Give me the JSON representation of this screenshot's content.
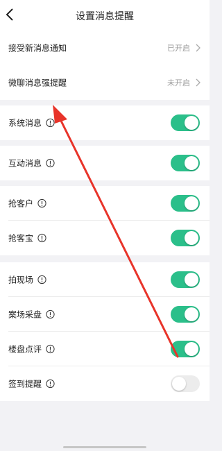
{
  "header": {
    "title": "设置消息提醒",
    "back_icon": "chevron-left-icon"
  },
  "notify_group": [
    {
      "label": "接受新消息通知",
      "value": "已开启"
    },
    {
      "label": "微聊消息强提醒",
      "value": "未开启"
    }
  ],
  "system_message": {
    "label": "系统消息",
    "on": true
  },
  "interaction_message": {
    "label": "互动消息",
    "on": true
  },
  "grab_group": [
    {
      "label": "抢客户",
      "on": true
    },
    {
      "label": "抢客宝",
      "on": true
    }
  ],
  "scene_group": [
    {
      "label": "拍现场",
      "on": true
    },
    {
      "label": "案场采盘",
      "on": true
    },
    {
      "label": "楼盘点评",
      "on": true
    },
    {
      "label": "签到提醒",
      "on": false
    }
  ],
  "colors": {
    "toggle_on": "#2bbf8a",
    "toggle_off": "#ececec",
    "annotation_arrow": "#e8342a"
  }
}
